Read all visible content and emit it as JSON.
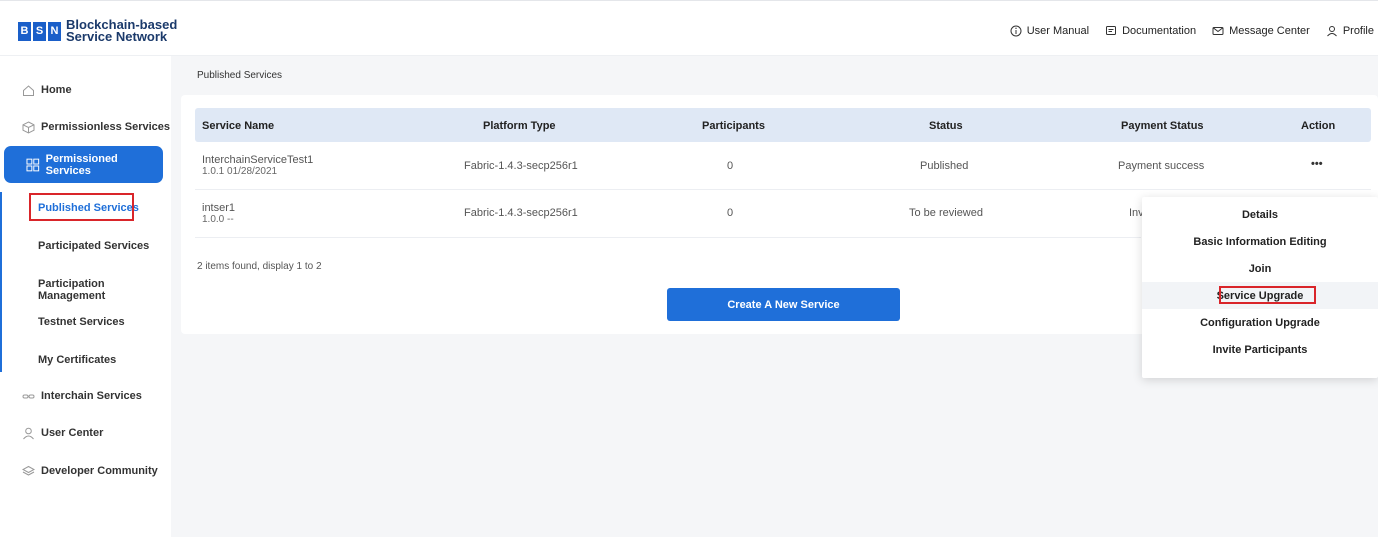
{
  "brand": {
    "logo_letters": [
      "B",
      "S",
      "N"
    ],
    "line1": "Blockchain-based",
    "line2": "Service Network"
  },
  "header": {
    "links": [
      "User Manual",
      "Documentation",
      "Message Center",
      "Profile"
    ]
  },
  "sidebar": {
    "items": [
      {
        "label": "Home",
        "icon": "home-icon"
      },
      {
        "label": "Permissionless Services",
        "icon": "cube-icon"
      },
      {
        "label": "Permissioned Services",
        "icon": "grid-icon"
      },
      {
        "label": "Interchain Services",
        "icon": "chain-icon"
      },
      {
        "label": "User Center",
        "icon": "user-icon"
      },
      {
        "label": "Developer Community",
        "icon": "layers-icon"
      }
    ],
    "sub_items": [
      "Published Services",
      "Participated Services",
      "Participation Management",
      "Testnet Services",
      "My Certificates"
    ]
  },
  "breadcrumb": "Published Services",
  "table": {
    "columns": [
      "Service Name",
      "Platform Type",
      "Participants",
      "Status",
      "Payment Status",
      "Action"
    ],
    "rows": [
      {
        "name": "InterchainServiceTest1",
        "version_date": "1.0.1  01/28/2021",
        "platform": "Fabric-1.4.3-secp256r1",
        "participants": "0",
        "status": "Published",
        "payment": "Payment success",
        "action": "•••"
      },
      {
        "name": "intser1",
        "version_date": "1.0.0  --",
        "platform": "Fabric-1.4.3-secp256r1",
        "participants": "0",
        "status": "To be reviewed",
        "payment": "Inv",
        "action": ""
      }
    ],
    "summary": "2 items found, display 1 to 2"
  },
  "create_button": "Create A New Service",
  "action_menu": {
    "items": [
      "Details",
      "Basic Information Editing",
      "Join",
      "Service Upgrade",
      "Configuration Upgrade",
      "Invite Participants"
    ],
    "highlighted": "Service Upgrade"
  },
  "colors": {
    "primary": "#1f6fd9",
    "highlight_box": "#d9252a",
    "table_header": "#dfe8f5"
  }
}
